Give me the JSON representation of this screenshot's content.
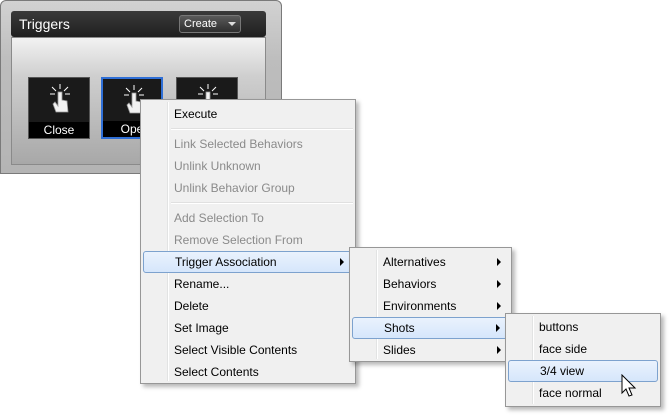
{
  "panel": {
    "title": "Triggers",
    "create_label": "Create",
    "tiles": [
      {
        "label": "Close"
      },
      {
        "label": "Ope"
      },
      {
        "label": ""
      }
    ]
  },
  "context_menu": {
    "items": {
      "execute": "Execute",
      "link_selected": "Link Selected Behaviors",
      "unlink_unknown": "Unlink Unknown",
      "unlink_group": "Unlink Behavior Group",
      "add_selection": "Add Selection To",
      "remove_selection": "Remove Selection From",
      "trigger_association": "Trigger Association",
      "rename": "Rename...",
      "delete": "Delete",
      "set_image": "Set Image",
      "select_visible": "Select Visible Contents",
      "select_contents": "Select Contents"
    }
  },
  "association_menu": {
    "items": {
      "alternatives": "Alternatives",
      "behaviors": "Behaviors",
      "environments": "Environments",
      "shots": "Shots",
      "slides": "Slides"
    }
  },
  "shots_menu": {
    "items": {
      "buttons": "buttons",
      "face_side": "face side",
      "three_quarter": "3/4 view",
      "face_normal": "face normal"
    }
  },
  "colors": {
    "selection_border": "#2f6fd6",
    "highlight_border": "#7da2ce",
    "menu_bg": "#f0f0f0"
  }
}
